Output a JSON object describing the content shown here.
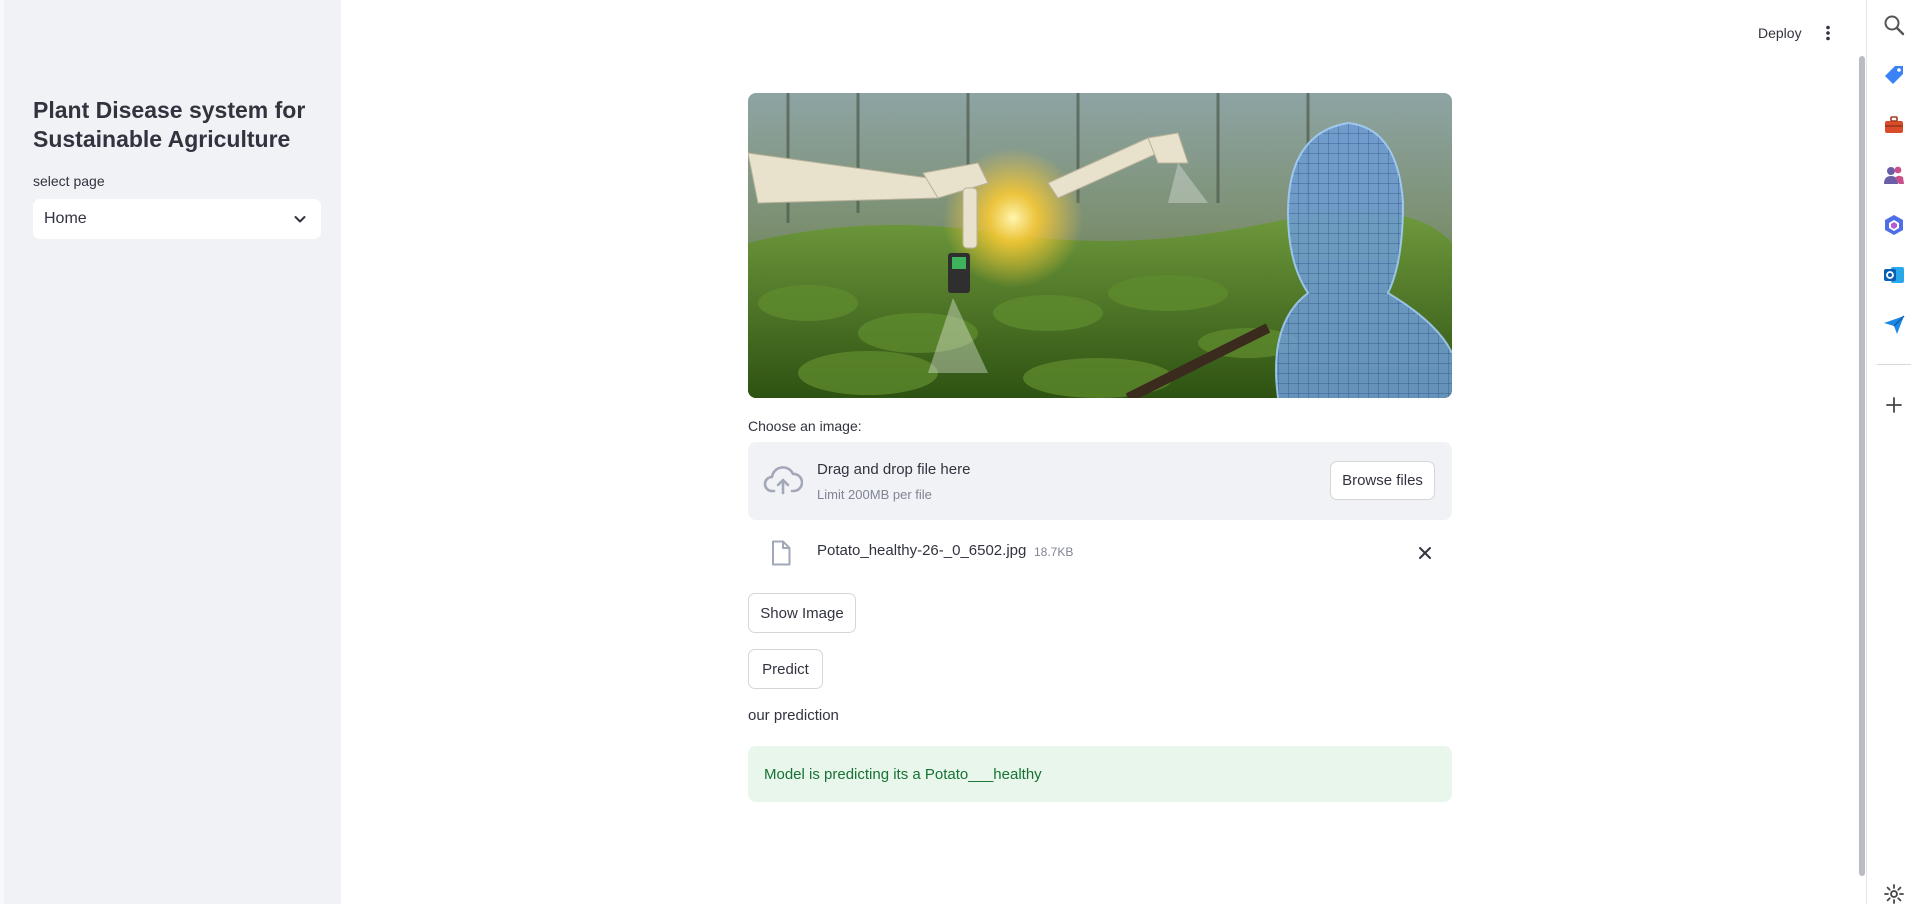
{
  "sidebar": {
    "title": "Plant Disease system for Sustainable Agriculture",
    "select_label": "select page",
    "select_value": "Home"
  },
  "header": {
    "deploy_label": "Deploy"
  },
  "main": {
    "uploader_label": "Choose an image:",
    "dropzone_title": "Drag and drop file here",
    "dropzone_limit": "Limit 200MB per file",
    "browse_label": "Browse files",
    "file": {
      "name": "Potato_healthy-26-_0_6502.jpg",
      "size": "18.7KB"
    },
    "show_image_label": "Show Image",
    "predict_label": "Predict",
    "prediction_heading": "our prediction",
    "prediction_result": "Model is predicting its a Potato___healthy"
  },
  "rightbar": {
    "icons": [
      "search-icon",
      "tag-icon",
      "toolbox-icon",
      "people-icon",
      "copilot-icon",
      "outlook-icon",
      "send-icon",
      "plus-icon",
      "gear-icon"
    ]
  },
  "colors": {
    "sidebar_bg": "#f0f2f6",
    "success_bg": "#e8f6ec",
    "success_text": "#177233"
  }
}
